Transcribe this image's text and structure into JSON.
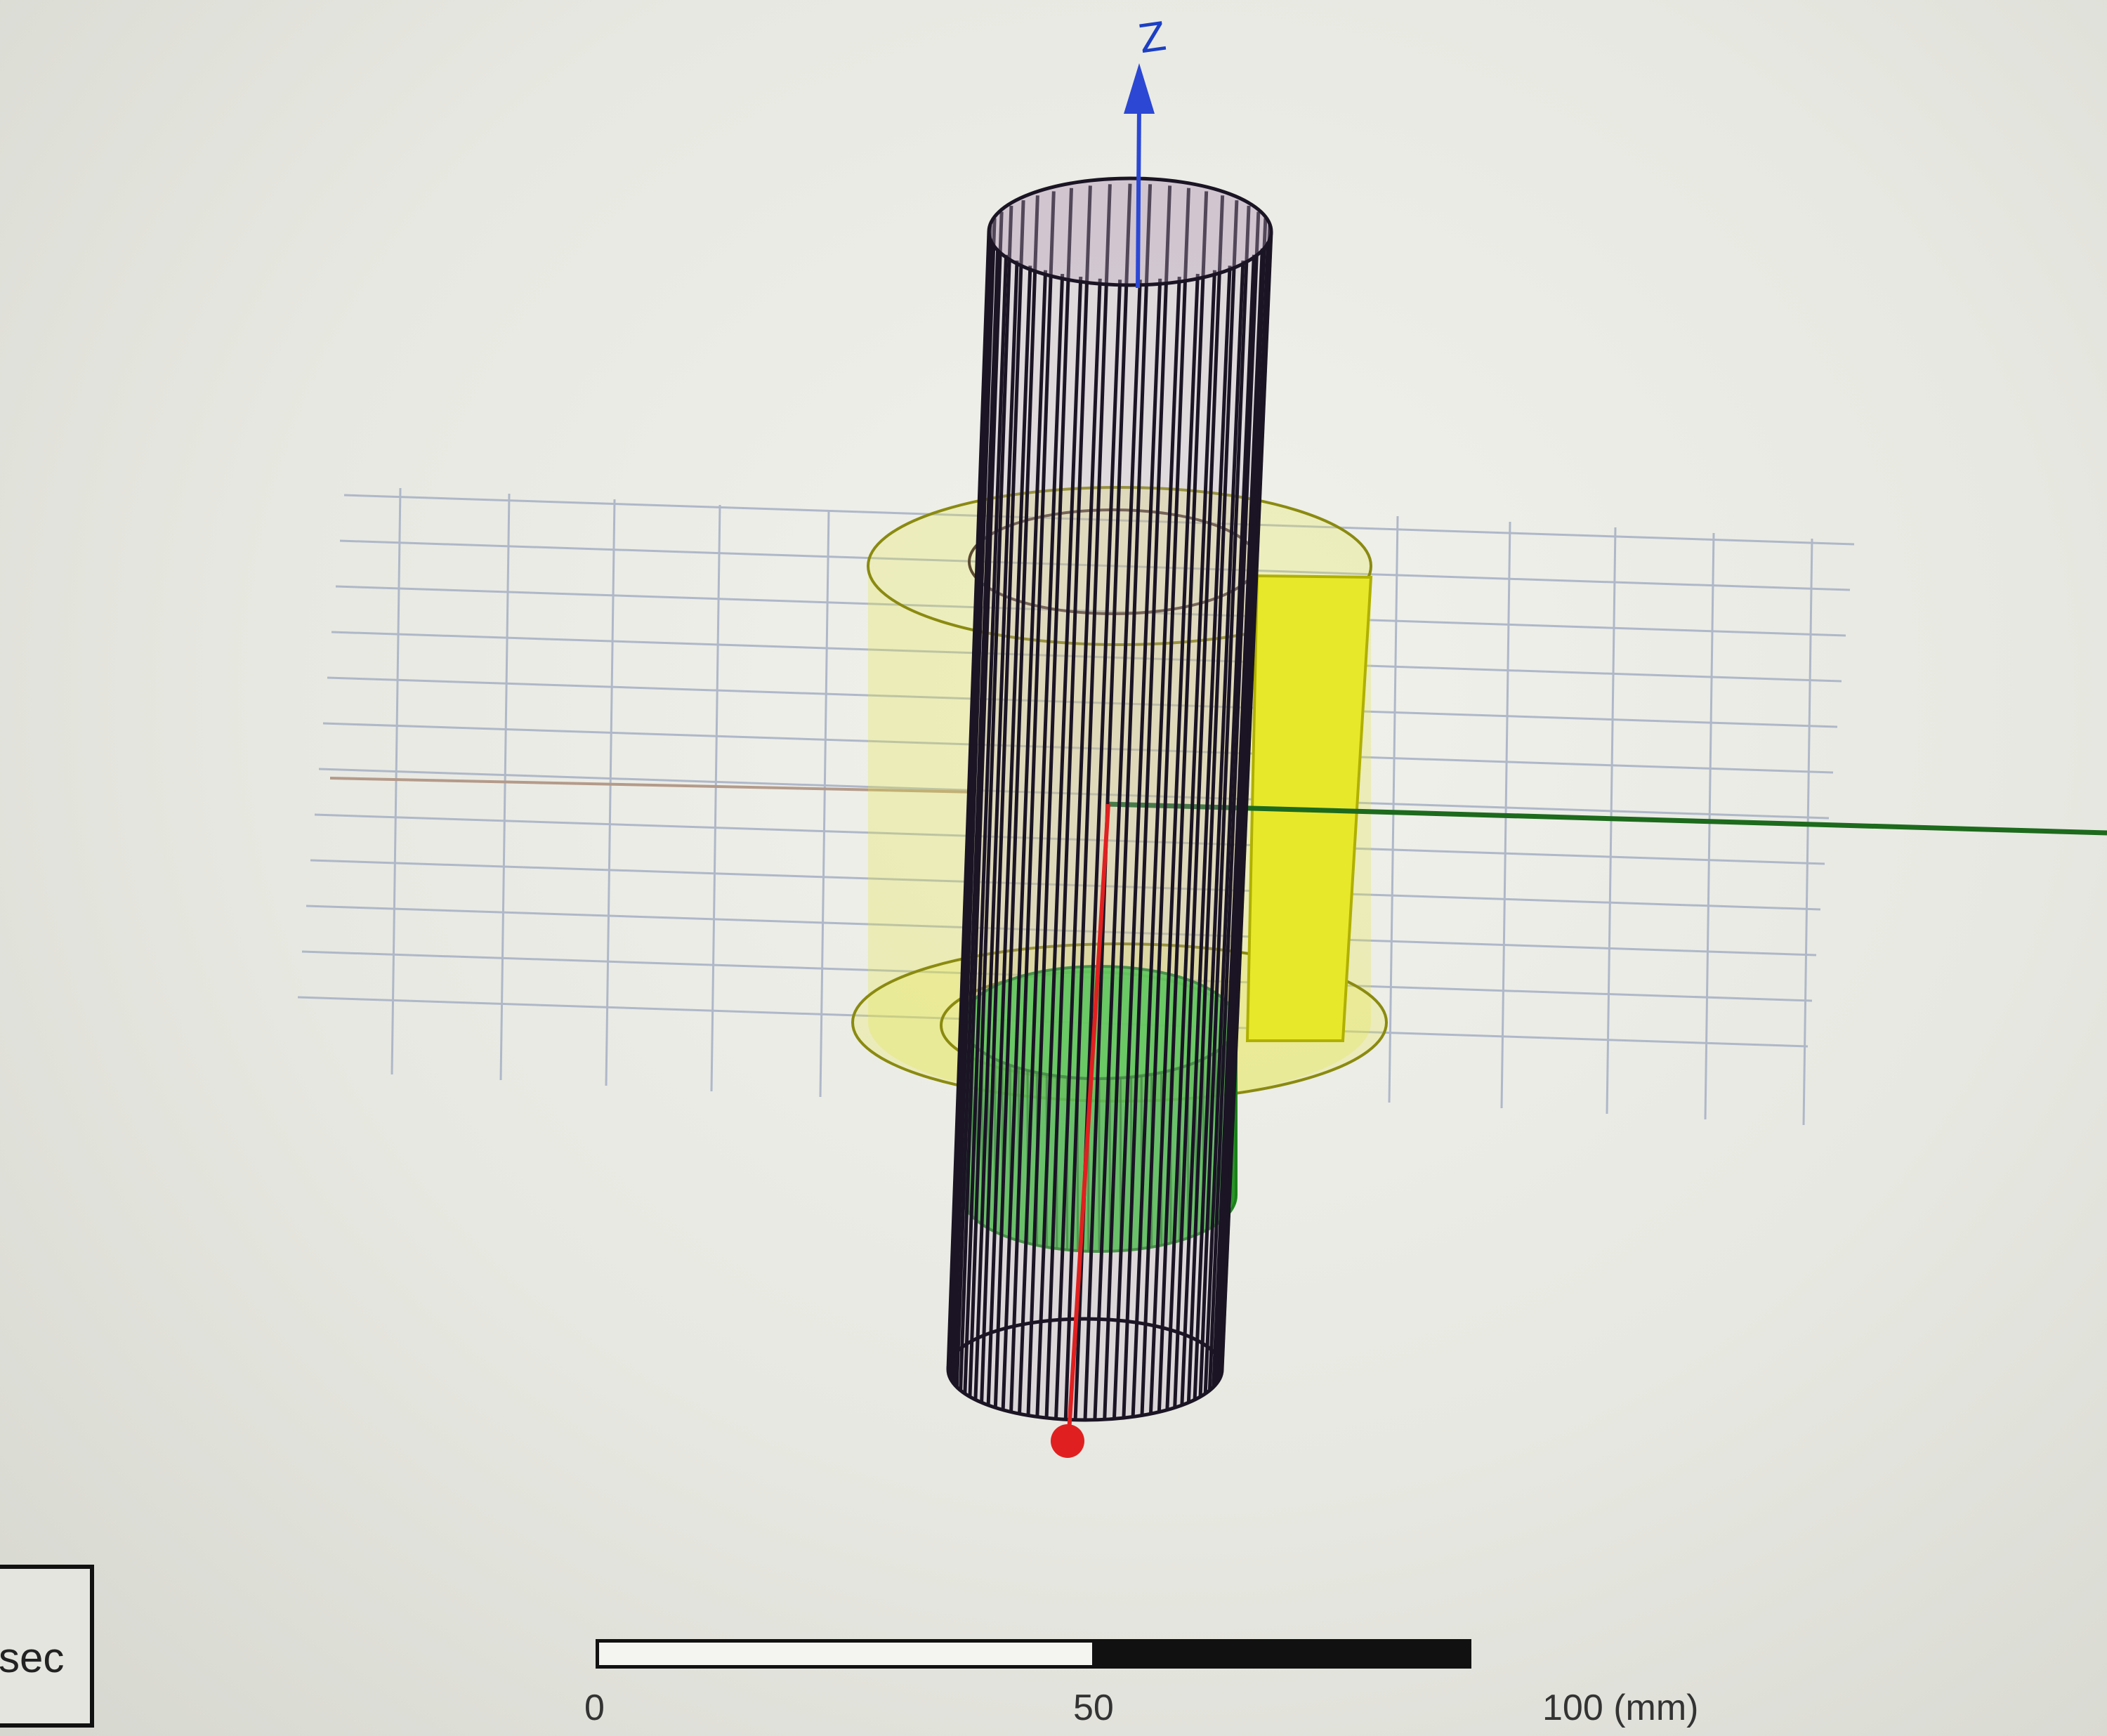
{
  "viewport": {
    "background_color": "#eceee8",
    "grid_color": "#a9b3c6",
    "axes": {
      "z_label": "Z",
      "z_color": "#2b47d4",
      "x_color": "#e02020",
      "y_color": "#1d6a1d"
    },
    "objects": [
      {
        "name": "tall-wire-cylinder",
        "color": "#1a1424",
        "fill": "#b9a6bd"
      },
      {
        "name": "yellow-ring-cylinder",
        "color": "#8a8a10",
        "fill": "#e6e63a"
      },
      {
        "name": "yellow-box",
        "color": "#b0b000",
        "fill": "#e8e82a"
      },
      {
        "name": "green-cylinder",
        "color": "#1c8a1c",
        "fill": "#2ec62e"
      }
    ]
  },
  "status": {
    "text": "sec"
  },
  "scale_bar": {
    "label_start": "0",
    "label_mid": "50",
    "label_end": "100 (mm)"
  }
}
